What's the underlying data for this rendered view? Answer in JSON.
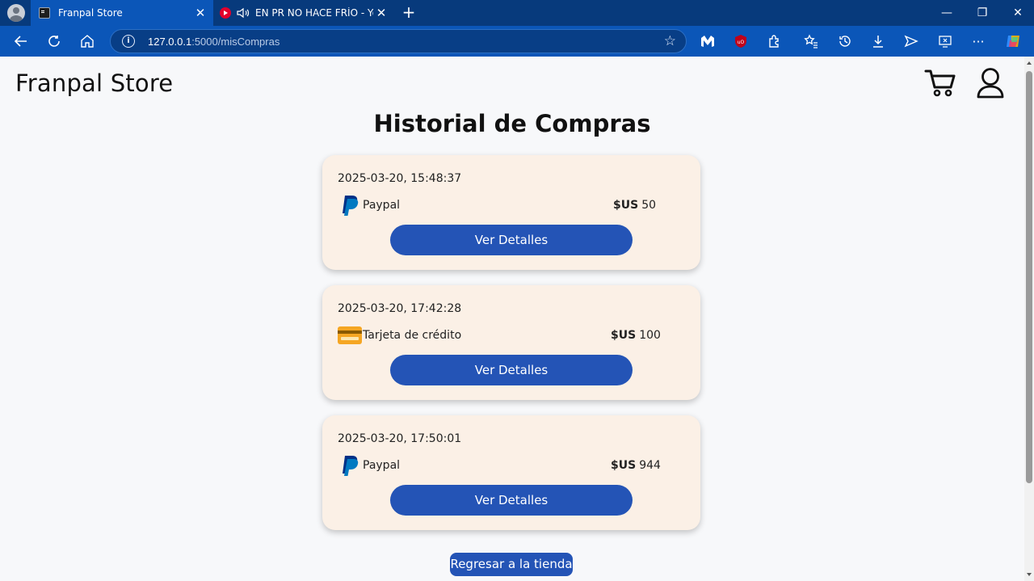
{
  "browser": {
    "tabs": [
      {
        "title": "Franpal Store",
        "active": true
      },
      {
        "title": "EN PR NO HACE FRÍO - YouT",
        "active": false
      }
    ],
    "address": {
      "host": "127.0.0.1",
      "rest": ":5000/misCompras"
    },
    "accent": "#0b56b8"
  },
  "store": {
    "brand": "Franpal Store",
    "heading": "Historial de Compras",
    "orders": [
      {
        "date": "2025-03-20, 15:48:37",
        "method": "Paypal",
        "method_icon": "paypal-icon",
        "currency": "$US",
        "amount": "50",
        "action": "Ver Detalles"
      },
      {
        "date": "2025-03-20, 17:42:28",
        "method": "Tarjeta de crédito",
        "method_icon": "credit-card-icon",
        "currency": "$US",
        "amount": "100",
        "action": "Ver Detalles"
      },
      {
        "date": "2025-03-20, 17:50:01",
        "method": "Paypal",
        "method_icon": "paypal-icon",
        "currency": "$US",
        "amount": "944",
        "action": "Ver Detalles"
      }
    ],
    "back_button": "Regresar a la tienda",
    "button_color": "#2454b6",
    "card_color": "#fbf0e6"
  }
}
